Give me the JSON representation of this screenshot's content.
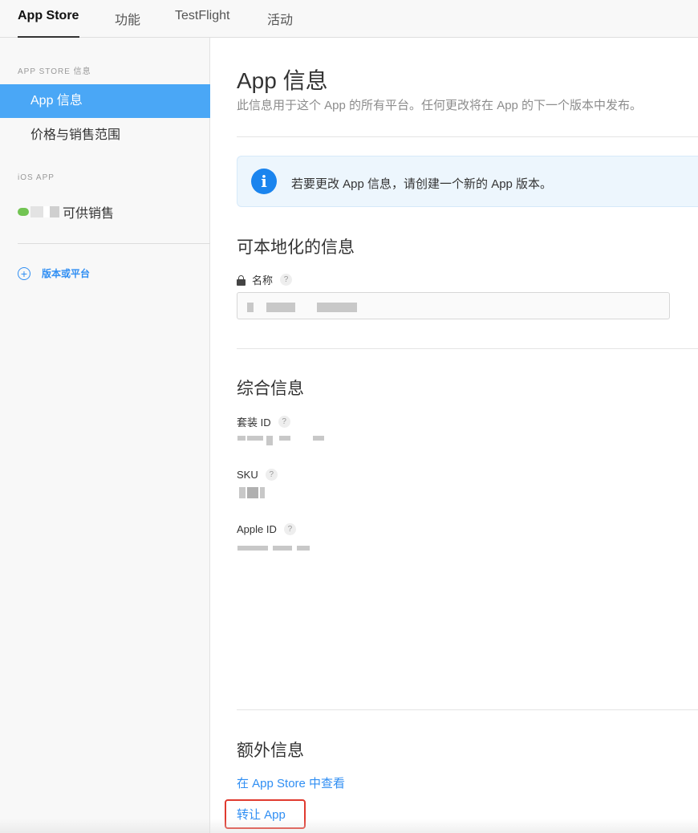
{
  "tabs": [
    {
      "label": "App Store",
      "active": true
    },
    {
      "label": "功能"
    },
    {
      "label": "TestFlight"
    },
    {
      "label": "活动"
    }
  ],
  "sidebar": {
    "app_store_header": "APP STORE 信息",
    "items": [
      {
        "label": "App 信息",
        "active": true
      },
      {
        "label": "价格与销售范围"
      }
    ],
    "ios_header": "iOS APP",
    "version_status": "可供销售",
    "add_label": "版本或平台"
  },
  "main": {
    "title": "App 信息",
    "subtitle": "此信息用于这个 App 的所有平台。任何更改将在 App 的下一个版本中发布。",
    "notice": "若要更改 App 信息，请创建一个新的 App 版本。",
    "localizable_title": "可本地化的信息",
    "name_label": "名称",
    "general_title": "综合信息",
    "bundle_id_label": "套装 ID",
    "sku_label": "SKU",
    "apple_id_label": "Apple ID",
    "additional_title": "额外信息",
    "view_link": "在 App Store 中查看",
    "transfer_link": "转让 App"
  },
  "help_glyph": "?",
  "info_glyph": "i",
  "add_glyph": "+",
  "colors": {
    "accent": "#2f8ef3",
    "sidebar_active": "#4aa7f6",
    "info_icon": "#1a84ee",
    "highlight_border": "#e03a2f",
    "status_green": "#72c453"
  }
}
